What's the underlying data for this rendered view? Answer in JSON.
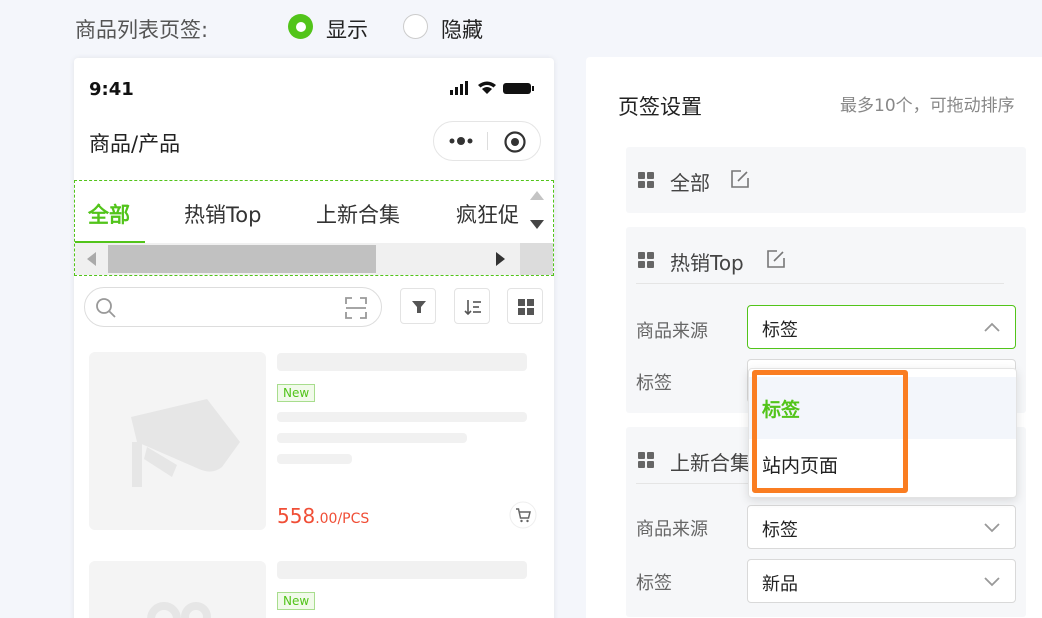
{
  "top_bar": {
    "label": "商品列表页签:",
    "options": [
      {
        "label": "显示",
        "selected": true
      },
      {
        "label": "隐藏",
        "selected": false
      }
    ]
  },
  "phone": {
    "time": "9:41",
    "title": "商品/产品",
    "tabs": [
      {
        "label": "全部",
        "active": true
      },
      {
        "label": "热销Top",
        "active": false
      },
      {
        "label": "上新合集",
        "active": false
      },
      {
        "label": "疯狂促",
        "active": false
      }
    ],
    "products": [
      {
        "badge": "New",
        "price_main": "558",
        "price_decimal": ".00",
        "price_unit": "/PCS"
      },
      {
        "badge": "New"
      }
    ]
  },
  "panel": {
    "title": "页签设置",
    "hint": "最多10个，可拖动排序",
    "groups": [
      {
        "title": "全部"
      },
      {
        "title": "热销Top",
        "fields": [
          {
            "label": "商品来源",
            "value": "标签"
          },
          {
            "label": "标签",
            "value": ""
          }
        ]
      },
      {
        "title": "上新合集",
        "fields": [
          {
            "label": "商品来源",
            "value": "标签"
          },
          {
            "label": "标签",
            "value": "新品"
          }
        ]
      }
    ],
    "dropdown": {
      "options": [
        {
          "label": "标签",
          "selected": true
        },
        {
          "label": "站内页面",
          "selected": false
        }
      ]
    }
  },
  "colors": {
    "accent": "#52c41a",
    "price": "#f04e36",
    "highlight": "#fa7d21"
  }
}
